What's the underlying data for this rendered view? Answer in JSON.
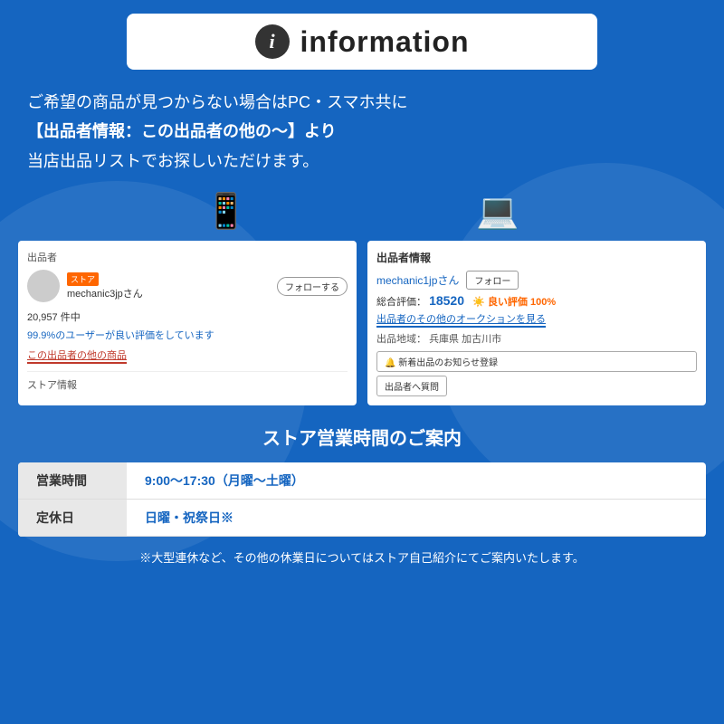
{
  "page": {
    "bg_color": "#1565c0"
  },
  "header": {
    "icon_label": "i",
    "title": "information"
  },
  "main_text": {
    "line1": "ご希望の商品が見つからない場合はPC・スマホ共に",
    "line2": "【出品者情報：この出品者の他の〜】より",
    "line3": "当店出品リストでお探しいただけます。"
  },
  "screenshots": {
    "left": {
      "label_seller": "出品者",
      "store_badge": "ストア",
      "seller_name": "mechanic3jpさん",
      "follow_label": "フォローする",
      "stats": "20,957 件中",
      "rating_text": "99.9%のユーザーが良い評価をしています",
      "other_items_link": "この出品者の他の商品",
      "store_info": "ストア情報"
    },
    "right": {
      "header": "出品者情報",
      "seller_name": "mechanic1jpさん",
      "follow_label": "フォロー",
      "total_rating_label": "総合評価：",
      "total_rating_value": "18520",
      "good_label": "良い評価",
      "good_percent": "100%",
      "auction_link": "出品者のその他のオークションを見る",
      "location_label": "出品地域：",
      "location_value": "兵庫県 加古川市",
      "notify_btn": "🔔 新着出品のお知らせ登録",
      "question_btn": "出品者へ質問"
    }
  },
  "store_hours": {
    "title": "ストア営業時間のご案内",
    "rows": [
      {
        "label": "営業時間",
        "value": "9:00〜17:30（月曜〜土曜）"
      },
      {
        "label": "定休日",
        "value": "日曜・祝祭日※"
      }
    ],
    "footer_note": "※大型連休など、その他の休業日についてはストア自己紹介にてご案内いたします。"
  }
}
